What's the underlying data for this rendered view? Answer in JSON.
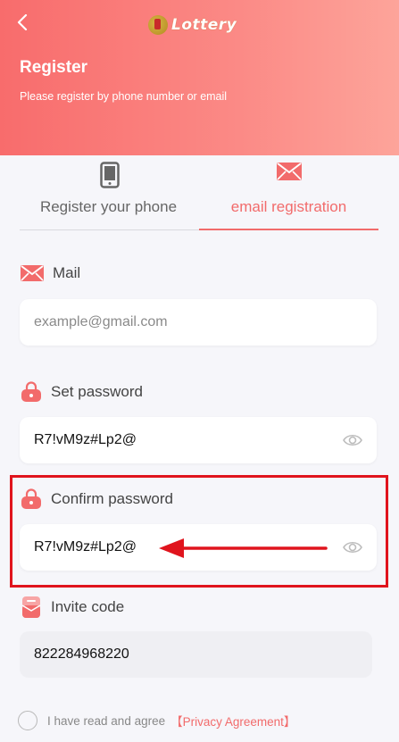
{
  "header": {
    "logo_text": "Lottery",
    "title": "Register",
    "subtitle": "Please register by phone number or email"
  },
  "tabs": [
    {
      "label": "Register your phone",
      "icon": "phone-icon",
      "active": false
    },
    {
      "label": "email registration",
      "icon": "mail-icon",
      "active": true
    }
  ],
  "form": {
    "mail": {
      "label": "Mail",
      "placeholder": "example@gmail.com",
      "value": ""
    },
    "set_password": {
      "label": "Set password",
      "value": "R7!vM9z#Lp2@"
    },
    "confirm_password": {
      "label": "Confirm password",
      "value": "R7!vM9z#Lp2@"
    },
    "invite_code": {
      "label": "Invite code",
      "value": "822284968220"
    }
  },
  "agreement": {
    "text": "I have read and agree",
    "link": "【Privacy Agreement】"
  },
  "colors": {
    "accent": "#f26b6b",
    "header_start": "#f86c6c",
    "header_end": "#fda49a",
    "highlight": "#e0141d"
  }
}
